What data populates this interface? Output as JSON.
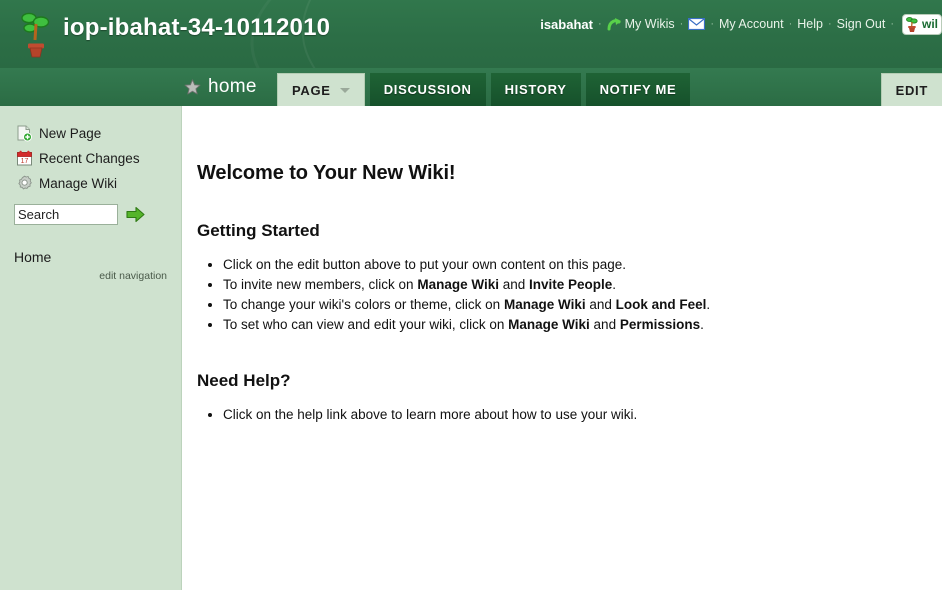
{
  "header": {
    "site_title": "iop-ibahat-34-10112010",
    "logo_icon": "plant-pot-icon",
    "brand_color": "#2d7048",
    "accent_color": "#1b5b31"
  },
  "userbar": {
    "username": "isabahat",
    "separator": "·",
    "my_wikis_icon": "curved-arrow-icon",
    "my_wikis_label": "My Wikis",
    "mail_icon": "envelope-icon",
    "my_account_label": "My Account",
    "help_label": "Help",
    "sign_out_label": "Sign Out",
    "wiki_badge": {
      "icon": "plant-pot-icon",
      "label": "wil"
    }
  },
  "tabbar": {
    "home_star_icon": "star-icon",
    "home_label": "home",
    "tabs": [
      {
        "label": "PAGE",
        "active": true,
        "caret_icon": "chevron-down-icon"
      },
      {
        "label": "DISCUSSION",
        "active": false
      },
      {
        "label": "HISTORY",
        "active": false
      },
      {
        "label": "NOTIFY ME",
        "active": false
      }
    ],
    "edit_button_label": "EDIT"
  },
  "sidebar": {
    "items": [
      {
        "label": "New Page",
        "icon": "new-page-icon"
      },
      {
        "label": "Recent Changes",
        "icon": "calendar-icon"
      },
      {
        "label": "Manage Wiki",
        "icon": "gear-icon"
      }
    ],
    "search": {
      "value": "Search",
      "placeholder": "Search",
      "go_icon": "green-arrow-icon"
    },
    "home_link_label": "Home",
    "edit_navigation_label": "edit navigation",
    "background_color": "#cfe2cf"
  },
  "content": {
    "page_title": "Welcome to Your New Wiki!",
    "getting_started_heading": "Getting Started",
    "getting_started_items": [
      {
        "parts": [
          {
            "text": "Click on the edit button above to put your own content on this page.",
            "bold": false
          }
        ]
      },
      {
        "parts": [
          {
            "text": "To invite new members, click on ",
            "bold": false
          },
          {
            "text": "Manage Wiki",
            "bold": true
          },
          {
            "text": " and ",
            "bold": false
          },
          {
            "text": "Invite People",
            "bold": true
          },
          {
            "text": ".",
            "bold": false
          }
        ]
      },
      {
        "parts": [
          {
            "text": "To change your wiki's colors or theme, click on ",
            "bold": false
          },
          {
            "text": "Manage Wiki",
            "bold": true
          },
          {
            "text": " and ",
            "bold": false
          },
          {
            "text": "Look and Feel",
            "bold": true
          },
          {
            "text": ".",
            "bold": false
          }
        ]
      },
      {
        "parts": [
          {
            "text": "To set who can view and edit your wiki, click on ",
            "bold": false
          },
          {
            "text": "Manage Wiki",
            "bold": true
          },
          {
            "text": " and ",
            "bold": false
          },
          {
            "text": "Permissions",
            "bold": true
          },
          {
            "text": ".",
            "bold": false
          }
        ]
      }
    ],
    "need_help_heading": "Need Help?",
    "need_help_items": [
      {
        "parts": [
          {
            "text": "Click on the help link above to learn more about how to use your wiki.",
            "bold": false
          }
        ]
      }
    ]
  }
}
